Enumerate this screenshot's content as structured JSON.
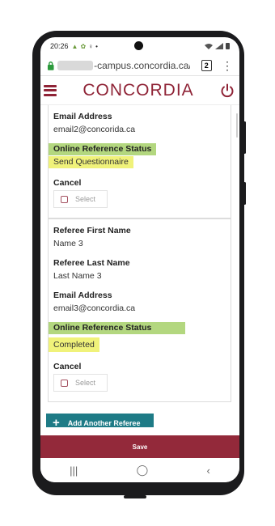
{
  "status_bar": {
    "time": "20:26",
    "icons_left": [
      "android-icon",
      "shield-icon",
      "person-icon",
      "dot"
    ],
    "icons_right": [
      "wifi-icon",
      "signal-icon",
      "battery-icon"
    ]
  },
  "browser": {
    "url_visible": "-campus.concordia.ca/p",
    "url_domain": "concordia.ca",
    "tab_count": "2"
  },
  "app": {
    "brand": "CONCORDIA",
    "brand_color": "#8f2336"
  },
  "referees": [
    {
      "email_label": "Email Address",
      "email": "email2@concorida.ca",
      "status_label": "Online Reference Status",
      "status": "Send Questionnaire",
      "cancel_label": "Cancel",
      "select_label": "Select"
    },
    {
      "first_name_label": "Referee First Name",
      "first_name": "Name 3",
      "last_name_label": "Referee Last Name",
      "last_name": "Last Name 3",
      "email_label": "Email Address",
      "email": "email3@concordia.ca",
      "status_label": "Online Reference Status",
      "status": "Completed",
      "cancel_label": "Cancel",
      "select_label": "Select"
    }
  ],
  "actions": {
    "add_referee": "Add Another Referee",
    "save": "Save"
  },
  "colors": {
    "highlight_green": "#b3d77f",
    "highlight_yellow": "#f0f27a",
    "button_teal": "#1e7b86",
    "save_red": "#93293a"
  }
}
